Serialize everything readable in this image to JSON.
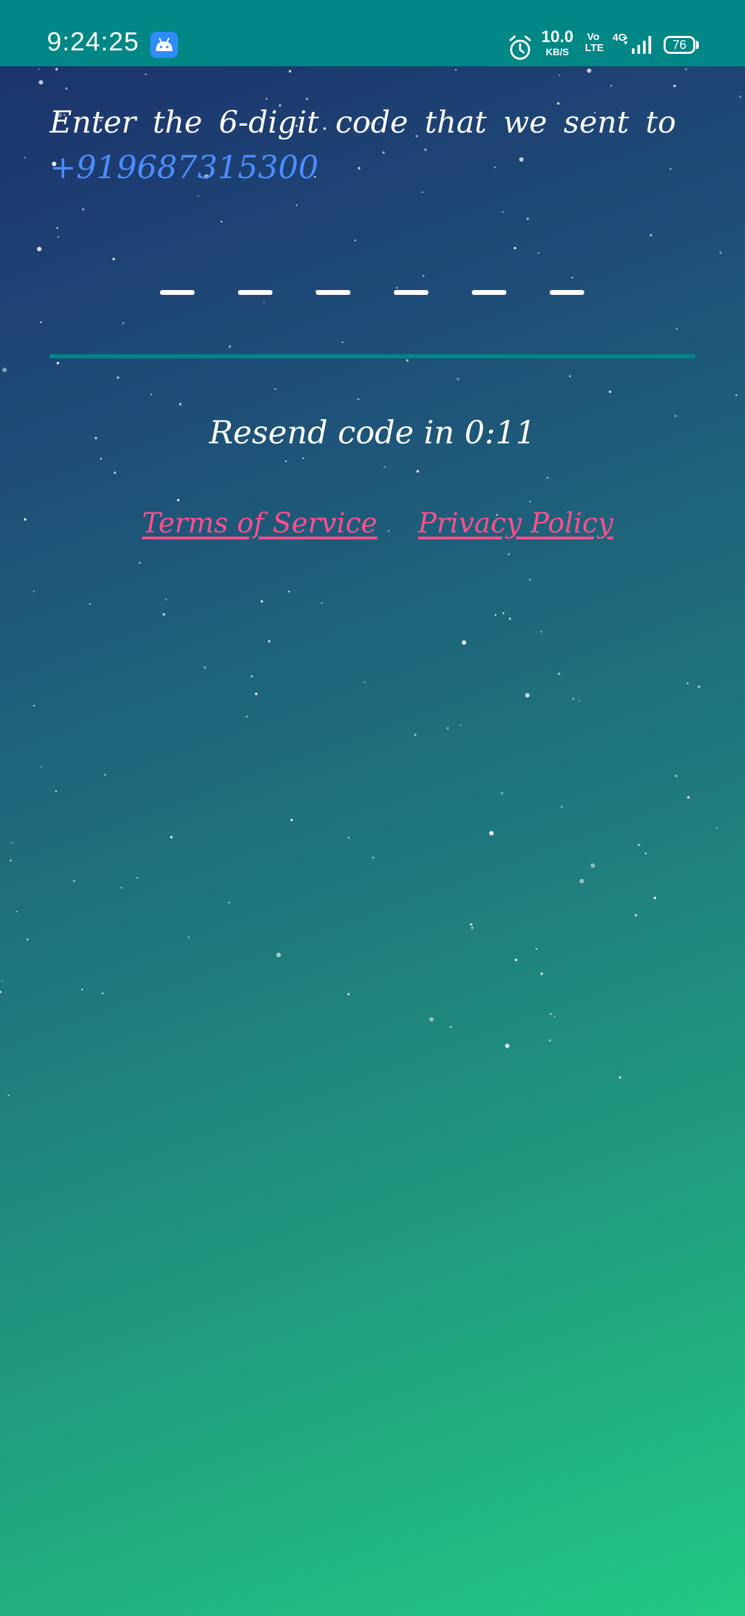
{
  "status_bar": {
    "time": "9:24:25",
    "app_icon": "android-icon",
    "alarm_icon": "alarm-clock-icon",
    "net_speed_value": "10.0",
    "net_speed_unit": "KB/S",
    "volte_top": "Vo",
    "volte_bottom": "LTE",
    "network_type": "4G",
    "signal_icon": "signal-bars-icon",
    "battery_level": "76"
  },
  "verification": {
    "instruction": "Enter the 6-digit code that we sent to",
    "phone_number": "+919687315300",
    "code_length": 6,
    "code_value": "",
    "resend_text": "Resend code in 0:11"
  },
  "links": {
    "terms": "Terms of Service",
    "privacy": "Privacy Policy"
  },
  "colors": {
    "status_bar": "#018786",
    "accent_underline": "#018786",
    "phone_number": "#4d8dff",
    "link": "#ff4f8b",
    "text": "#ffffff"
  }
}
